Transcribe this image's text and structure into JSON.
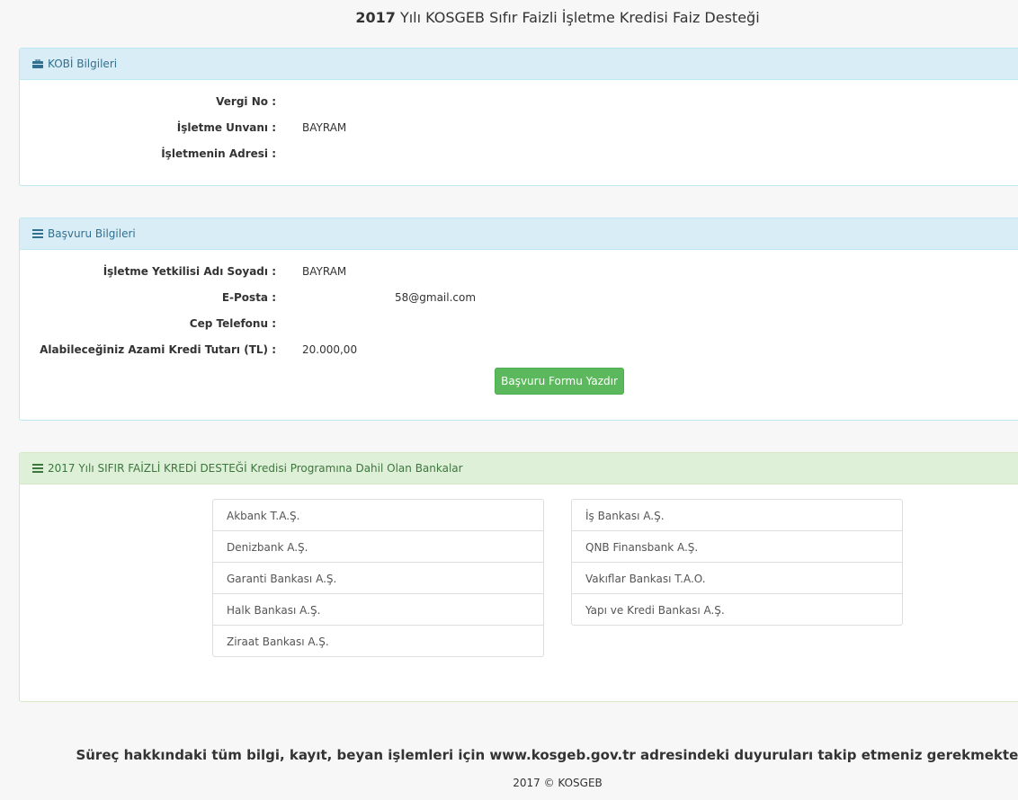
{
  "title": {
    "year": "2017",
    "text": " Yılı KOSGEB Sıfır Faizli İşletme Kredisi Faiz Desteği"
  },
  "kobi": {
    "heading": "KOBİ Bilgileri",
    "fields": [
      {
        "label": "Vergi No :",
        "value": ""
      },
      {
        "label": "İşletme Unvanı :",
        "value": "BAYRAM"
      },
      {
        "label": "İşletmenin Adresi :",
        "value": ""
      }
    ]
  },
  "basvuru": {
    "heading": "Başvuru Bilgileri",
    "fields": [
      {
        "label": "İşletme Yetkilisi Adı Soyadı :",
        "value": "BAYRAM"
      },
      {
        "label": "E-Posta :",
        "value": "                           58@gmail.com"
      },
      {
        "label": "Cep Telefonu :",
        "value": ""
      },
      {
        "label": "Alabileceğiniz Azami Kredi Tutarı (TL) :",
        "value": "20.000,00"
      }
    ],
    "print_button": "Başvuru Formu Yazdır"
  },
  "banks": {
    "heading": "2017 Yılı SIFIR FAİZLİ KREDİ DESTEĞİ Kredisi Programına Dahil Olan Bankalar",
    "left": [
      "Akbank T.A.Ş.",
      "Denizbank A.Ş.",
      "Garanti Bankası A.Ş.",
      "Halk Bankası A.Ş.",
      "Ziraat Bankası A.Ş."
    ],
    "right": [
      "İş Bankası A.Ş.",
      "QNB Finansbank A.Ş.",
      "Vakıflar Bankası T.A.O.",
      "Yapı ve Kredi Bankası A.Ş."
    ]
  },
  "footer": {
    "note": "Süreç hakkındaki tüm bilgi, kayıt, beyan işlemleri için www.kosgeb.gov.tr adresindeki duyuruları takip etmeniz gerekmektedir",
    "copyright": "2017 © KOSGEB"
  },
  "icons": {
    "kobi": "briefcase-icon",
    "basvuru": "list-icon",
    "banks": "list-icon"
  },
  "colors": {
    "info_heading": "#d9edf7",
    "success_heading": "#dff0d8",
    "button": "#5cb85c"
  }
}
